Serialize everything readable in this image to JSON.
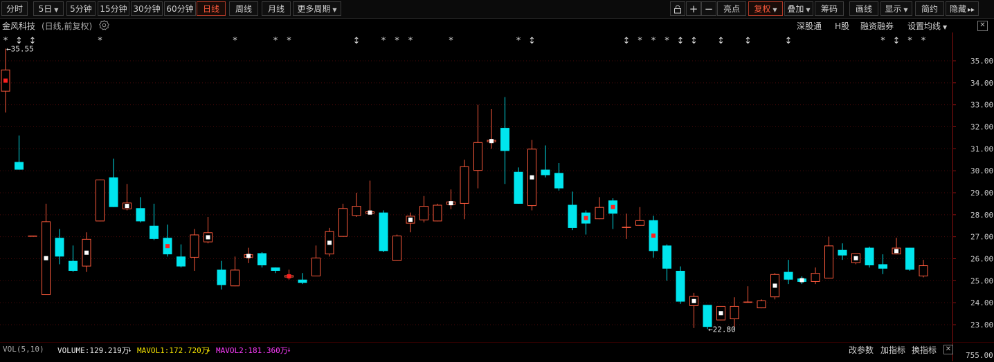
{
  "toolbar": {
    "periods": [
      "分时",
      "5日",
      "5分钟",
      "15分钟",
      "30分钟",
      "60分钟",
      "日线",
      "周线",
      "月线",
      "更多周期"
    ],
    "active_period": "日线",
    "right_buttons": [
      "亮点",
      "复权",
      "叠加",
      "筹码",
      "画线",
      "显示",
      "简约",
      "隐藏"
    ],
    "active_right": "复权",
    "hide_arrows": "▸▸"
  },
  "infobar": {
    "stock_name": "金风科技",
    "chart_desc": "(日线,前复权)",
    "links": [
      "深股通",
      "H股",
      "融资融券",
      "设置均线"
    ]
  },
  "chart_data": {
    "type": "candlestick",
    "y_ticks": [
      "35.00",
      "34.00",
      "33.00",
      "32.00",
      "31.00",
      "30.00",
      "29.00",
      "28.00",
      "27.00",
      "26.00",
      "25.00",
      "24.00",
      "23.00"
    ],
    "ylim": [
      22.45,
      36.2
    ],
    "max_label": "35.55",
    "min_label": "22.80",
    "up_color": "#ff5a3c",
    "down_color": "#00e5ee",
    "candles": [
      {
        "o": 33.6,
        "h": 35.55,
        "l": 32.65,
        "c": 34.6
      },
      {
        "o": 30.4,
        "h": 31.6,
        "l": 30.05,
        "c": 30.05
      },
      {
        "o": 27.05,
        "h": 27.05,
        "l": 27.05,
        "c": 27.05
      },
      {
        "o": 24.35,
        "h": 28.5,
        "l": 24.35,
        "c": 27.7
      },
      {
        "o": 26.95,
        "h": 27.35,
        "l": 25.75,
        "c": 26.1
      },
      {
        "o": 25.9,
        "h": 26.6,
        "l": 25.4,
        "c": 25.45
      },
      {
        "o": 25.65,
        "h": 27.2,
        "l": 25.4,
        "c": 26.9
      },
      {
        "o": 27.7,
        "h": 29.6,
        "l": 27.7,
        "c": 29.6
      },
      {
        "o": 29.7,
        "h": 30.55,
        "l": 28.35,
        "c": 28.35
      },
      {
        "o": 28.25,
        "h": 29.4,
        "l": 28.2,
        "c": 28.55
      },
      {
        "o": 28.3,
        "h": 28.8,
        "l": 27.65,
        "c": 27.7
      },
      {
        "o": 27.5,
        "h": 28.5,
        "l": 26.85,
        "c": 26.9
      },
      {
        "o": 26.95,
        "h": 27.55,
        "l": 26.1,
        "c": 26.2
      },
      {
        "o": 26.1,
        "h": 26.65,
        "l": 25.6,
        "c": 25.65
      },
      {
        "o": 26.05,
        "h": 27.35,
        "l": 25.45,
        "c": 27.1
      },
      {
        "o": 26.75,
        "h": 27.9,
        "l": 26.7,
        "c": 27.2
      },
      {
        "o": 25.5,
        "h": 25.9,
        "l": 24.6,
        "c": 24.8
      },
      {
        "o": 24.75,
        "h": 26.1,
        "l": 24.75,
        "c": 25.5
      },
      {
        "o": 26.05,
        "h": 26.5,
        "l": 25.8,
        "c": 26.2
      },
      {
        "o": 26.25,
        "h": 26.3,
        "l": 25.6,
        "c": 25.7
      },
      {
        "o": 25.6,
        "h": 25.6,
        "l": 25.35,
        "c": 25.45
      },
      {
        "o": 25.15,
        "h": 25.5,
        "l": 25.05,
        "c": 25.25
      },
      {
        "o": 25.05,
        "h": 25.35,
        "l": 24.85,
        "c": 24.9
      },
      {
        "o": 25.2,
        "h": 26.6,
        "l": 25.2,
        "c": 26.05
      },
      {
        "o": 26.2,
        "h": 27.4,
        "l": 26.1,
        "c": 27.25
      },
      {
        "o": 27.0,
        "h": 28.5,
        "l": 27.0,
        "c": 28.3
      },
      {
        "o": 27.95,
        "h": 29.0,
        "l": 27.9,
        "c": 28.4
      },
      {
        "o": 28.05,
        "h": 29.55,
        "l": 28.0,
        "c": 28.15
      },
      {
        "o": 28.1,
        "h": 28.2,
        "l": 26.3,
        "c": 26.35
      },
      {
        "o": 25.9,
        "h": 27.1,
        "l": 25.9,
        "c": 27.05
      },
      {
        "o": 27.6,
        "h": 28.1,
        "l": 27.2,
        "c": 27.95
      },
      {
        "o": 27.75,
        "h": 28.85,
        "l": 27.65,
        "c": 28.4
      },
      {
        "o": 27.7,
        "h": 28.5,
        "l": 27.7,
        "c": 28.45
      },
      {
        "o": 28.45,
        "h": 29.15,
        "l": 28.25,
        "c": 28.6
      },
      {
        "o": 28.5,
        "h": 30.5,
        "l": 27.8,
        "c": 30.2
      },
      {
        "o": 30.0,
        "h": 33.0,
        "l": 29.2,
        "c": 31.3
      },
      {
        "o": 31.3,
        "h": 32.8,
        "l": 31.0,
        "c": 31.4
      },
      {
        "o": 31.95,
        "h": 33.35,
        "l": 29.4,
        "c": 30.9
      },
      {
        "o": 29.95,
        "h": 30.15,
        "l": 28.5,
        "c": 28.5
      },
      {
        "o": 28.4,
        "h": 31.4,
        "l": 28.2,
        "c": 31.0
      },
      {
        "o": 30.05,
        "h": 31.15,
        "l": 29.7,
        "c": 29.8
      },
      {
        "o": 29.9,
        "h": 30.35,
        "l": 29.1,
        "c": 29.2
      },
      {
        "o": 28.45,
        "h": 29.05,
        "l": 27.3,
        "c": 27.4
      },
      {
        "o": 28.1,
        "h": 28.2,
        "l": 27.1,
        "c": 27.6
      },
      {
        "o": 27.8,
        "h": 28.8,
        "l": 27.8,
        "c": 28.35
      },
      {
        "o": 28.65,
        "h": 28.75,
        "l": 27.35,
        "c": 28.05
      },
      {
        "o": 27.4,
        "h": 28.05,
        "l": 26.9,
        "c": 27.45
      },
      {
        "o": 27.5,
        "h": 28.35,
        "l": 27.5,
        "c": 27.75
      },
      {
        "o": 27.75,
        "h": 27.95,
        "l": 26.05,
        "c": 26.35
      },
      {
        "o": 26.6,
        "h": 26.65,
        "l": 25.0,
        "c": 25.55
      },
      {
        "o": 25.45,
        "h": 25.65,
        "l": 23.95,
        "c": 24.05
      },
      {
        "o": 23.85,
        "h": 24.45,
        "l": 22.85,
        "c": 24.3
      },
      {
        "o": 23.9,
        "h": 23.9,
        "l": 22.8,
        "c": 22.9
      },
      {
        "o": 23.2,
        "h": 23.85,
        "l": 23.2,
        "c": 23.85
      },
      {
        "o": 23.25,
        "h": 24.25,
        "l": 22.85,
        "c": 23.85
      },
      {
        "o": 24.0,
        "h": 24.75,
        "l": 24.0,
        "c": 24.05
      },
      {
        "o": 23.75,
        "h": 24.15,
        "l": 23.75,
        "c": 24.1
      },
      {
        "o": 24.25,
        "h": 25.35,
        "l": 24.15,
        "c": 25.3
      },
      {
        "o": 25.4,
        "h": 25.95,
        "l": 24.85,
        "c": 25.05
      },
      {
        "o": 25.1,
        "h": 25.2,
        "l": 24.85,
        "c": 24.95
      },
      {
        "o": 24.95,
        "h": 25.6,
        "l": 24.85,
        "c": 25.35
      },
      {
        "o": 25.1,
        "h": 27.0,
        "l": 25.1,
        "c": 26.6
      },
      {
        "o": 26.4,
        "h": 26.7,
        "l": 25.95,
        "c": 26.15
      },
      {
        "o": 25.8,
        "h": 26.25,
        "l": 25.75,
        "c": 26.25
      },
      {
        "o": 26.5,
        "h": 26.55,
        "l": 25.6,
        "c": 25.7
      },
      {
        "o": 25.75,
        "h": 26.2,
        "l": 25.3,
        "c": 25.55
      },
      {
        "o": 26.2,
        "h": 26.95,
        "l": 26.2,
        "c": 26.5
      },
      {
        "o": 26.5,
        "h": 26.5,
        "l": 25.45,
        "c": 25.5
      },
      {
        "o": 25.2,
        "h": 25.95,
        "l": 25.15,
        "c": 25.7
      }
    ],
    "markers": {
      "0": "*",
      "1": "↕",
      "2": "↕",
      "7": "*",
      "17": "*",
      "20": "*",
      "21": "*",
      "26": "↕",
      "28": "*",
      "29": "*",
      "30": "*",
      "33": "*",
      "38": "*",
      "39": "↕",
      "46": "↕",
      "47": "*",
      "48": "*",
      "49": "*",
      "50": "↕",
      "51": "↕",
      "53": "↕",
      "55": "↕",
      "58": "↕",
      "65": "*",
      "66": "↕",
      "67": "*",
      "68": "*"
    },
    "dots": {
      "0": "red",
      "3": "white",
      "6": "white",
      "9": "white",
      "12": "red",
      "15": "white",
      "18": "white",
      "21": "red",
      "24": "white",
      "27": "white",
      "30": "white",
      "33": "white",
      "36": "white",
      "39": "white",
      "43": "red",
      "45": "red",
      "48": "red",
      "51": "white",
      "53": "white",
      "57": "white",
      "59": "white",
      "63": "white",
      "66": "white"
    }
  },
  "volume": {
    "indicator": "VOL(5,10)",
    "volume_label": "VOLUME:129.219万",
    "volume_arrow": "↓",
    "mavol1_label": "MAVOL1:172.720万",
    "mavol1_arrow": "↓",
    "mavol2_label": "MAVOL2:181.360万",
    "mavol2_arrow": "↓",
    "buttons": [
      "改参数",
      "加指标",
      "换指标"
    ],
    "axis_value": "755.00"
  }
}
